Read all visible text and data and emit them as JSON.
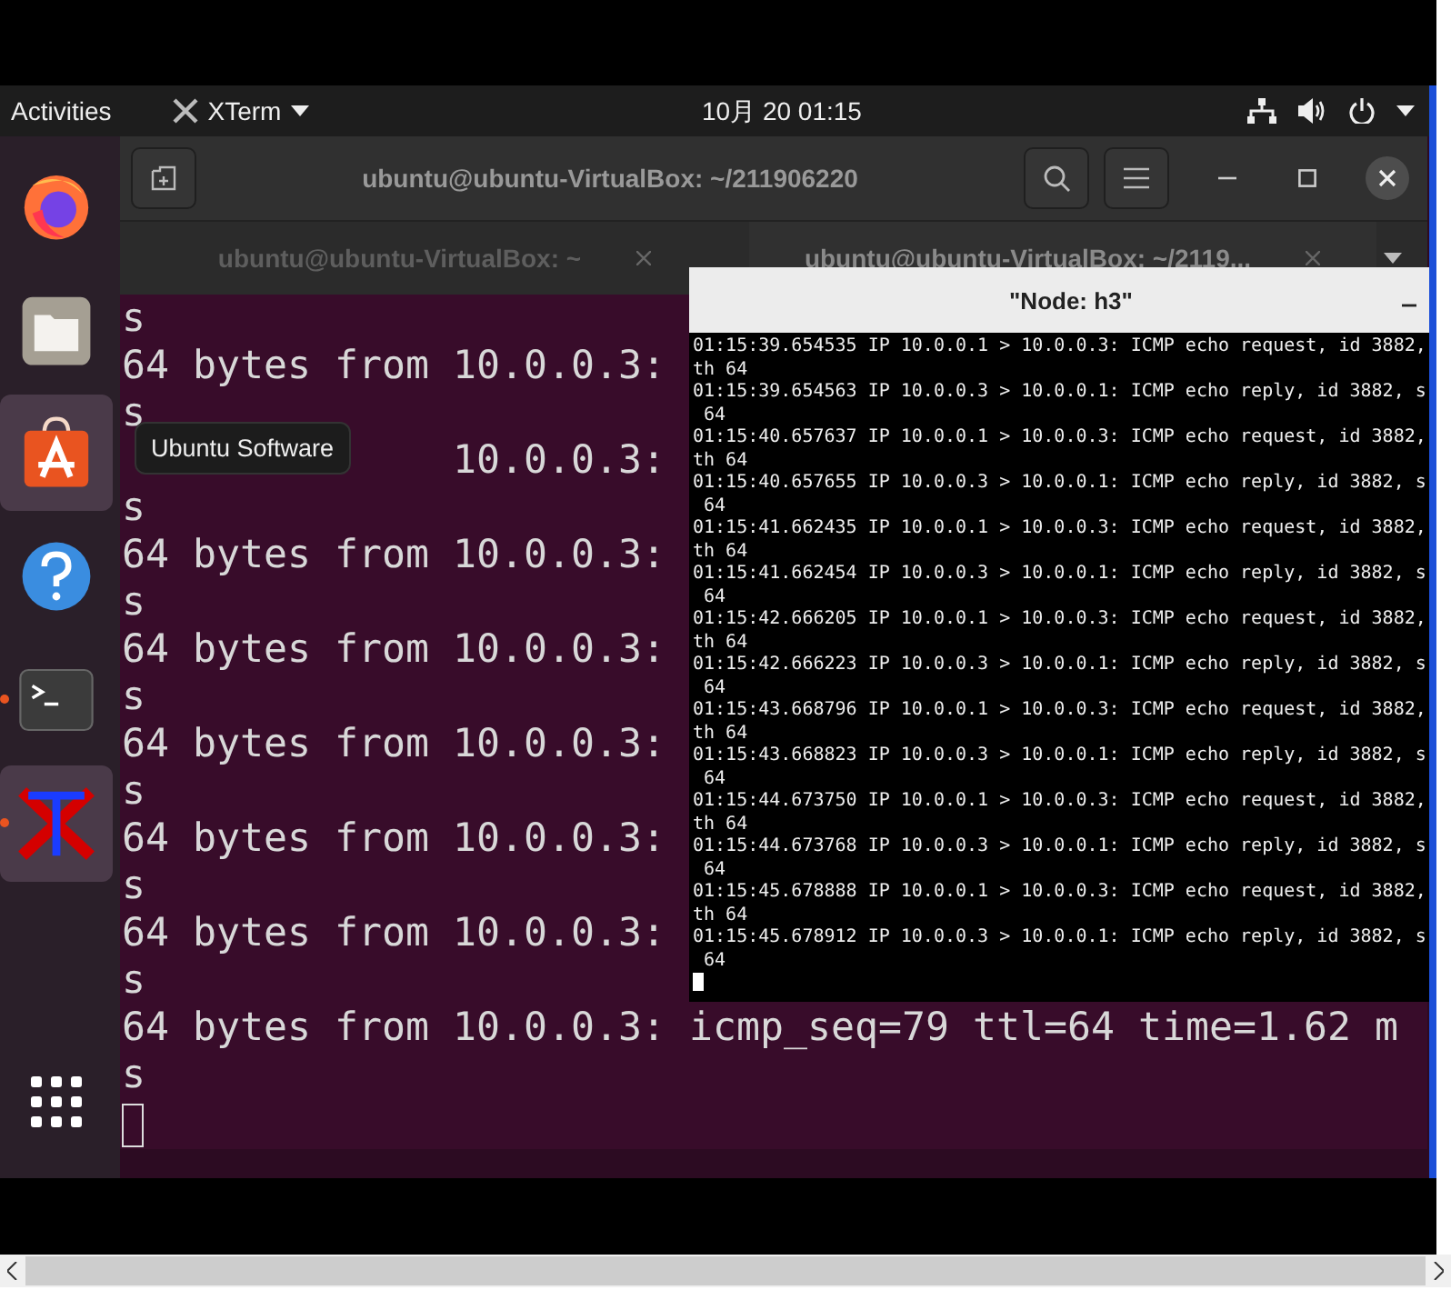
{
  "top_bar": {
    "activities": "Activities",
    "app_menu": "XTerm",
    "clock": "10月 20  01:15"
  },
  "dock": {
    "items": [
      {
        "kind": "firefox",
        "running": false,
        "highlighted": false
      },
      {
        "kind": "files",
        "running": false,
        "highlighted": false
      },
      {
        "kind": "software",
        "running": false,
        "highlighted": true
      },
      {
        "kind": "help",
        "running": false,
        "highlighted": false
      },
      {
        "kind": "terminal",
        "running": true,
        "highlighted": false
      },
      {
        "kind": "xterm",
        "running": true,
        "highlighted": true
      }
    ],
    "tooltip": "Ubuntu Software"
  },
  "terminal": {
    "title": "ubuntu@ubuntu-VirtualBox: ~/211906220",
    "tabs": [
      {
        "label": "ubuntu@ubuntu-VirtualBox: ~",
        "selected": false
      },
      {
        "label": "ubuntu@ubuntu-VirtualBox: ~/2119...",
        "selected": true
      }
    ],
    "lines": [
      "s",
      "64 bytes from 10.0.0.3:",
      "s",
      "              10.0.0.3:",
      "s",
      "64 bytes from 10.0.0.3:",
      "s",
      "64 bytes from 10.0.0.3:",
      "s",
      "64 bytes from 10.0.0.3:",
      "s",
      "64 bytes from 10.0.0.3:",
      "s",
      "64 bytes from 10.0.0.3:",
      "s",
      "64 bytes from 10.0.0.3: icmp_seq=79 ttl=64 time=1.62 m",
      "s"
    ]
  },
  "xterm": {
    "title": "\"Node: h3\"",
    "lines": [
      "01:15:39.654535 IP 10.0.0.1 > 10.0.0.3: ICMP echo request, id 3882,",
      "th 64",
      "01:15:39.654563 IP 10.0.0.3 > 10.0.0.1: ICMP echo reply, id 3882, s",
      " 64",
      "01:15:40.657637 IP 10.0.0.1 > 10.0.0.3: ICMP echo request, id 3882,",
      "th 64",
      "01:15:40.657655 IP 10.0.0.3 > 10.0.0.1: ICMP echo reply, id 3882, s",
      " 64",
      "01:15:41.662435 IP 10.0.0.1 > 10.0.0.3: ICMP echo request, id 3882,",
      "th 64",
      "01:15:41.662454 IP 10.0.0.3 > 10.0.0.1: ICMP echo reply, id 3882, s",
      " 64",
      "01:15:42.666205 IP 10.0.0.1 > 10.0.0.3: ICMP echo request, id 3882,",
      "th 64",
      "01:15:42.666223 IP 10.0.0.3 > 10.0.0.1: ICMP echo reply, id 3882, s",
      " 64",
      "01:15:43.668796 IP 10.0.0.1 > 10.0.0.3: ICMP echo request, id 3882,",
      "th 64",
      "01:15:43.668823 IP 10.0.0.3 > 10.0.0.1: ICMP echo reply, id 3882, s",
      " 64",
      "01:15:44.673750 IP 10.0.0.1 > 10.0.0.3: ICMP echo request, id 3882,",
      "th 64",
      "01:15:44.673768 IP 10.0.0.3 > 10.0.0.1: ICMP echo reply, id 3882, s",
      " 64",
      "01:15:45.678888 IP 10.0.0.1 > 10.0.0.3: ICMP echo request, id 3882,",
      "th 64",
      "01:15:45.678912 IP 10.0.0.3 > 10.0.0.1: ICMP echo reply, id 3882, s",
      " 64"
    ]
  }
}
